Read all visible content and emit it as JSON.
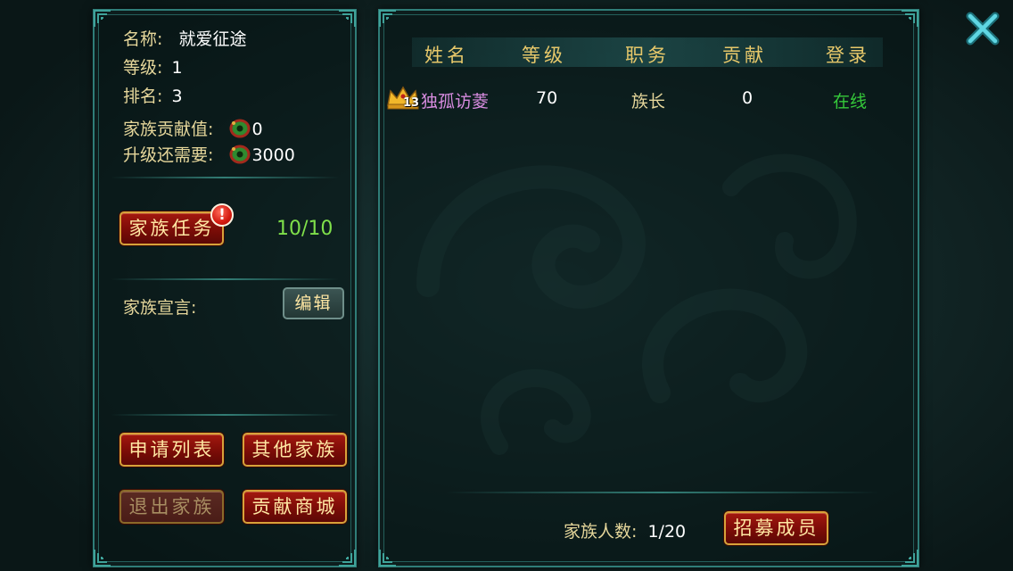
{
  "left_panel": {
    "name_label": "名称:",
    "name_value": "就爱征途",
    "level_label": "等级:",
    "level_value": "1",
    "rank_label": "排名:",
    "rank_value": "3",
    "contribution_label": "家族贡献值:",
    "contribution_value": "0",
    "upgrade_label": "升级还需要:",
    "upgrade_value": "3000",
    "task_button": "家族任务",
    "task_alert": "!",
    "task_progress": "10/10",
    "declaration_label": "家族宣言:",
    "edit_button": "编辑",
    "buttons": {
      "apply_list": "申请列表",
      "other_families": "其他家族",
      "leave_family": "退出家族",
      "contribution_shop": "贡献商城"
    }
  },
  "member_table": {
    "headers": [
      "姓名",
      "等级",
      "职务",
      "贡献",
      "登录"
    ],
    "rows": [
      {
        "vip_level": "13",
        "name": "独孤访菱",
        "level": "70",
        "position": "族长",
        "contribution": "0",
        "status": "在线"
      }
    ]
  },
  "footer": {
    "member_count_label": "家族人数:",
    "member_count_value": "1/20",
    "recruit_button": "招募成员"
  },
  "colors": {
    "label_gold": "#e6d79b",
    "header_gold": "#e7c86a",
    "progress_green": "#7fe04a",
    "online_green": "#35c93a",
    "name_purple": "#d88ce0",
    "frame_teal": "#2f7d78"
  },
  "icons": {
    "close": "close-x-icon",
    "coin": "coin-icon",
    "crown": "crown-icon"
  }
}
